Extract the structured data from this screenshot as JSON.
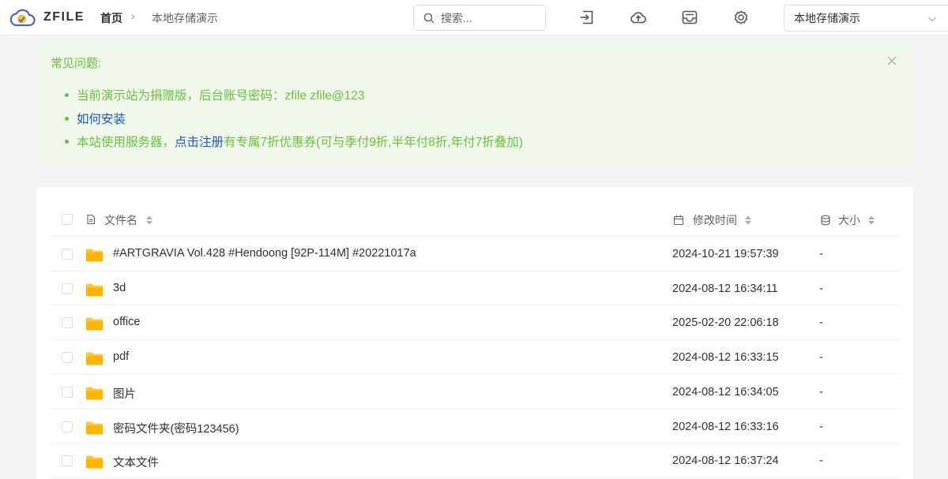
{
  "header": {
    "brand": "ZFILE",
    "breadcrumb": {
      "home": "首页",
      "separator": "›",
      "current": "本地存储演示"
    },
    "search_placeholder": "搜索...",
    "storage_select": "本地存储演示",
    "tools": [
      "login-icon",
      "upload-icon",
      "drive-icon",
      "settings-icon"
    ]
  },
  "notice": {
    "title": "常见问题:",
    "items": [
      {
        "text": "当前演示站为捐赠版，后台账号密码：zfile zfile@123"
      },
      {
        "link": "如何安装"
      },
      {
        "prefix": "本站使用服务器，",
        "link": "点击注册",
        "suffix": "有专属7折优惠券(可与季付9折,半年付8折,年付7折叠加)"
      }
    ]
  },
  "table": {
    "columns": {
      "name": "文件名",
      "time": "修改时间",
      "size": "大小"
    },
    "rows": [
      {
        "name": "#ARTGRAVIA Vol.428 #Hendoong [92P-114M] #20221017a",
        "time": "2024-10-21 19:57:39",
        "size": "-"
      },
      {
        "name": "3d",
        "time": "2024-08-12 16:34:11",
        "size": "-"
      },
      {
        "name": "office",
        "time": "2025-02-20 22:06:18",
        "size": "-"
      },
      {
        "name": "pdf",
        "time": "2024-08-12 16:33:15",
        "size": "-"
      },
      {
        "name": "图片",
        "time": "2024-08-12 16:34:05",
        "size": "-"
      },
      {
        "name": "密码文件夹(密码123456)",
        "time": "2024-08-12 16:33:16",
        "size": "-"
      },
      {
        "name": "文本文件",
        "time": "2024-08-12 16:37:24",
        "size": "-"
      }
    ]
  },
  "colors": {
    "notice_green": "#67c23a",
    "notice_bg": "#f0f9eb",
    "link_blue": "#1a56c8",
    "folder_yellow": "#ffc53d"
  }
}
